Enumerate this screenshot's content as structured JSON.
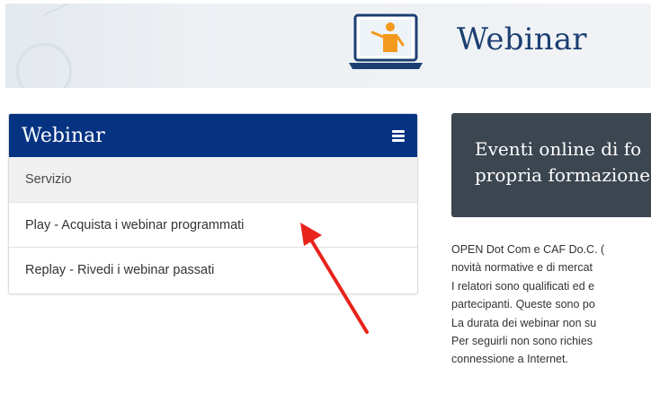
{
  "banner": {
    "title": "Webinar",
    "icon": "presenter-laptop-icon"
  },
  "menu": {
    "title": "Webinar",
    "menu_icon": "hamburger-icon",
    "items": [
      {
        "label": "Servizio",
        "type": "section"
      },
      {
        "label": "Play - Acquista i webinar programmati"
      },
      {
        "label": "Replay - Rivedi i webinar passati"
      }
    ]
  },
  "highlight": {
    "lines": [
      "Eventi online di fo",
      "propria formazione"
    ]
  },
  "body": {
    "lines": [
      "OPEN Dot Com e CAF Do.C. (",
      "novità normative e di mercat",
      "I relatori sono qualificati ed e",
      "partecipanti. Queste sono po",
      "La durata dei webinar non su",
      "Per seguirli non sono richies",
      "connessione a Internet."
    ]
  },
  "colors": {
    "menu_header": "#053382",
    "banner_title": "#1c3f73",
    "dark_box": "#3c4651",
    "arrow": "#e8231b"
  }
}
